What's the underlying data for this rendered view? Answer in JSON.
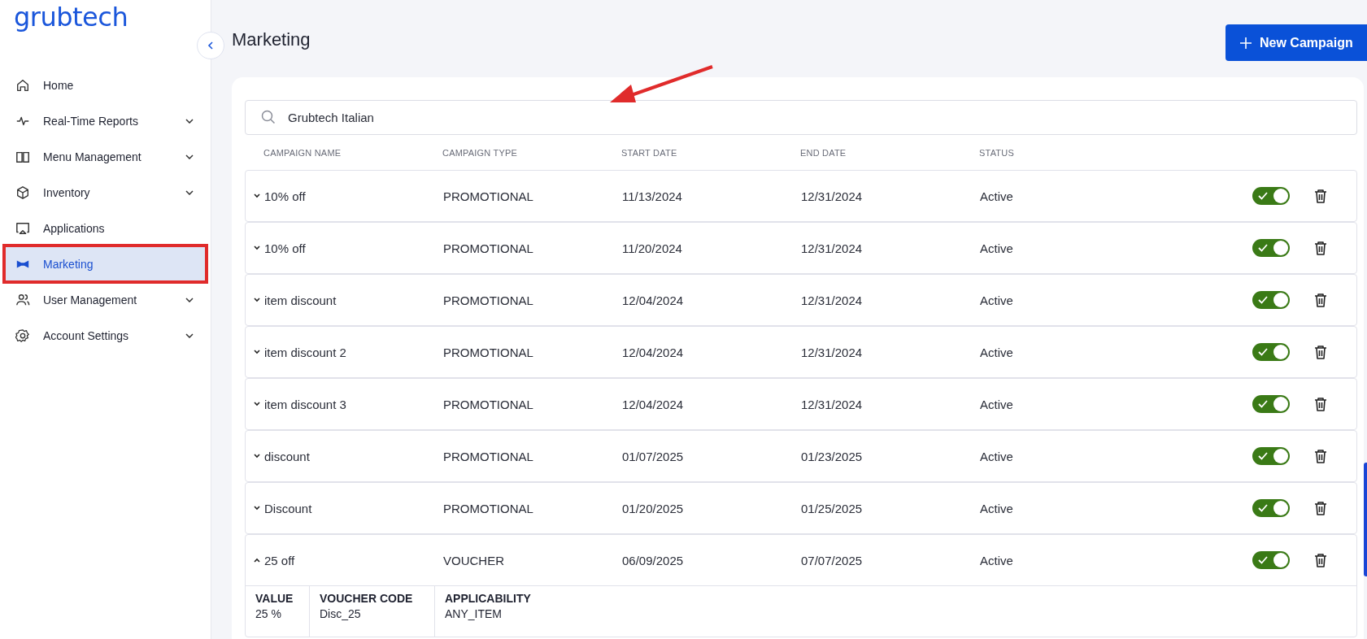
{
  "sidebar": {
    "logo": "grubtech",
    "items": [
      {
        "label": "Home",
        "kind": "home",
        "expandable": false,
        "selected": false,
        "highlighted": false
      },
      {
        "label": "Real-Time Reports",
        "kind": "pulse",
        "expandable": true,
        "selected": false,
        "highlighted": false
      },
      {
        "label": "Menu Management",
        "kind": "book",
        "expandable": true,
        "selected": false,
        "highlighted": false
      },
      {
        "label": "Inventory",
        "kind": "cube",
        "expandable": true,
        "selected": false,
        "highlighted": false
      },
      {
        "label": "Applications",
        "kind": "monitor",
        "expandable": false,
        "selected": false,
        "highlighted": false
      },
      {
        "label": "Marketing",
        "kind": "megaphone",
        "expandable": false,
        "selected": true,
        "highlighted": true
      },
      {
        "label": "User Management",
        "kind": "users",
        "expandable": true,
        "selected": false,
        "highlighted": false
      },
      {
        "label": "Account Settings",
        "kind": "gear",
        "expandable": true,
        "selected": false,
        "highlighted": false
      }
    ]
  },
  "page": {
    "title": "Marketing",
    "new_button": "New Campaign"
  },
  "search": {
    "value": "Grubtech Italian"
  },
  "table": {
    "columns": [
      "CAMPAIGN NAME",
      "CAMPAIGN TYPE",
      "START DATE",
      "END DATE",
      "STATUS"
    ],
    "rows": [
      {
        "name": "10% off",
        "type": "PROMOTIONAL",
        "start": "11/13/2024",
        "end": "12/31/2024",
        "status": "Active",
        "enabled": true,
        "expanded": false
      },
      {
        "name": "10% off",
        "type": "PROMOTIONAL",
        "start": "11/20/2024",
        "end": "12/31/2024",
        "status": "Active",
        "enabled": true,
        "expanded": false
      },
      {
        "name": "item discount",
        "type": "PROMOTIONAL",
        "start": "12/04/2024",
        "end": "12/31/2024",
        "status": "Active",
        "enabled": true,
        "expanded": false
      },
      {
        "name": "item discount 2",
        "type": "PROMOTIONAL",
        "start": "12/04/2024",
        "end": "12/31/2024",
        "status": "Active",
        "enabled": true,
        "expanded": false
      },
      {
        "name": "item discount 3",
        "type": "PROMOTIONAL",
        "start": "12/04/2024",
        "end": "12/31/2024",
        "status": "Active",
        "enabled": true,
        "expanded": false
      },
      {
        "name": "discount",
        "type": "PROMOTIONAL",
        "start": "01/07/2025",
        "end": "01/23/2025",
        "status": "Active",
        "enabled": true,
        "expanded": false
      },
      {
        "name": "Discount",
        "type": "PROMOTIONAL",
        "start": "01/20/2025",
        "end": "01/25/2025",
        "status": "Active",
        "enabled": true,
        "expanded": false
      },
      {
        "name": "25 off",
        "type": "VOUCHER",
        "start": "06/09/2025",
        "end": "07/07/2025",
        "status": "Active",
        "enabled": true,
        "expanded": true,
        "details": [
          {
            "label": "VALUE",
            "value": "25 %"
          },
          {
            "label": "VOUCHER CODE",
            "value": "Disc_25"
          },
          {
            "label": "APPLICABILITY",
            "value": "ANY_ITEM"
          }
        ]
      }
    ]
  }
}
